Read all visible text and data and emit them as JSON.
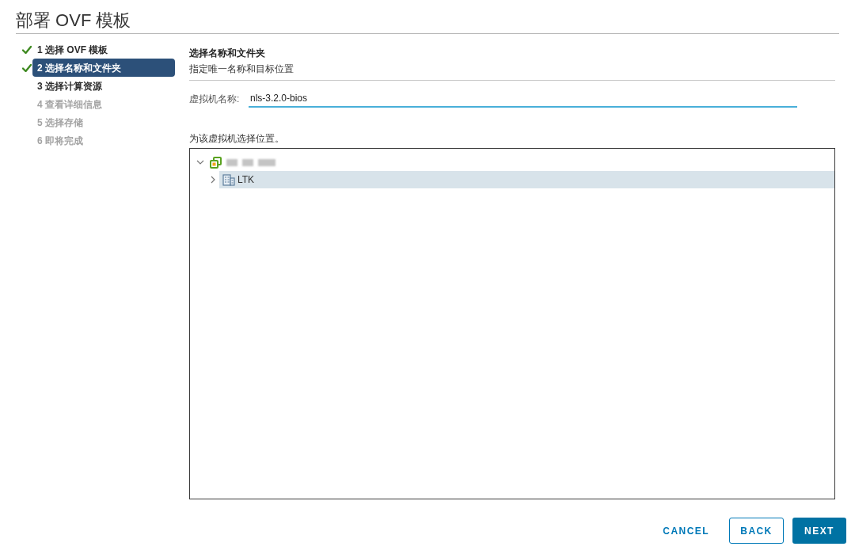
{
  "title": "部署 OVF 模板",
  "steps": [
    {
      "label": "1 选择 OVF 模板",
      "completed": true,
      "selected": false,
      "disabled": false
    },
    {
      "label": "2 选择名称和文件夹",
      "completed": true,
      "selected": true,
      "disabled": false
    },
    {
      "label": "3 选择计算资源",
      "completed": false,
      "selected": false,
      "disabled": false
    },
    {
      "label": "4 查看详细信息",
      "completed": false,
      "selected": false,
      "disabled": true
    },
    {
      "label": "5 选择存储",
      "completed": false,
      "selected": false,
      "disabled": true
    },
    {
      "label": "6 即将完成",
      "completed": false,
      "selected": false,
      "disabled": true
    }
  ],
  "panel": {
    "heading": "选择名称和文件夹",
    "subheading": "指定唯一名称和目标位置"
  },
  "vm_name": {
    "label": "虚拟机名称:",
    "value": "nls-3.2.0-bios"
  },
  "location": {
    "label": "为该虚拟机选择位置。",
    "tree": [
      {
        "kind": "datacenter",
        "expanded": true,
        "selected": false,
        "children": [
          {
            "kind": "folder",
            "label": "LTK",
            "expanded": false,
            "selected": true
          }
        ]
      }
    ]
  },
  "buttons": [
    {
      "label": "CANCEL",
      "kind": "flat"
    },
    {
      "label": "BACK",
      "kind": "outline"
    },
    {
      "label": "NEXT",
      "kind": "primary"
    }
  ]
}
